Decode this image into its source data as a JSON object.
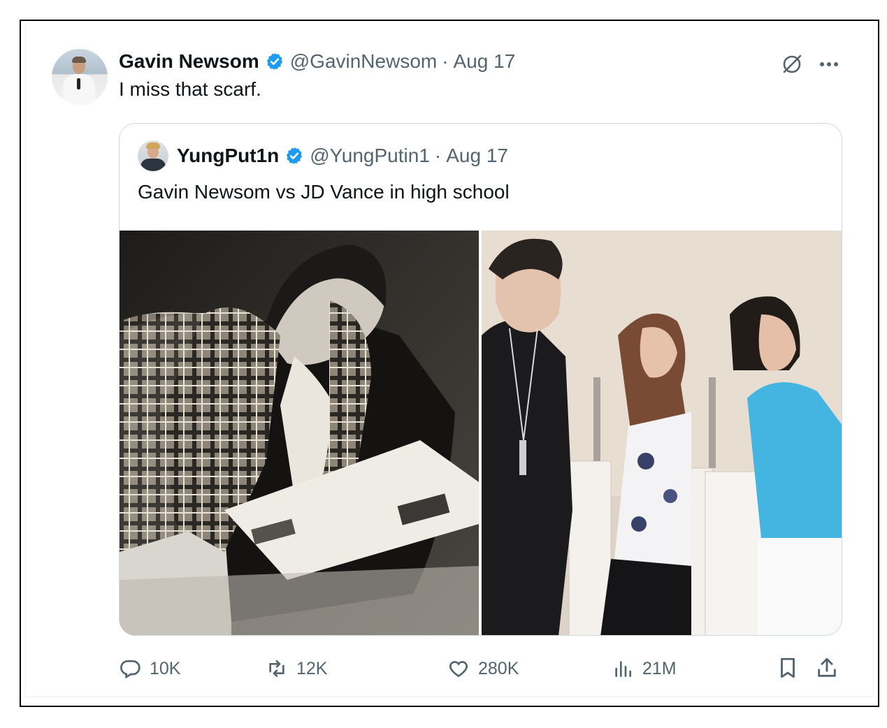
{
  "tweet": {
    "author_name": "Gavin Newsom",
    "handle": "@GavinNewsom",
    "separator": "·",
    "date": "Aug 17",
    "text": "I miss that scarf."
  },
  "quoted": {
    "author_name": "YungPut1n",
    "handle": "@YungPutin1",
    "separator": "·",
    "date": "Aug 17",
    "text": "Gavin Newsom vs JD Vance in high school"
  },
  "actions": {
    "replies": "10K",
    "reposts": "12K",
    "likes": "280K",
    "views": "21M"
  },
  "colors": {
    "verified": "#1d9bf0",
    "muted": "#536471",
    "border": "#cfd9de"
  }
}
